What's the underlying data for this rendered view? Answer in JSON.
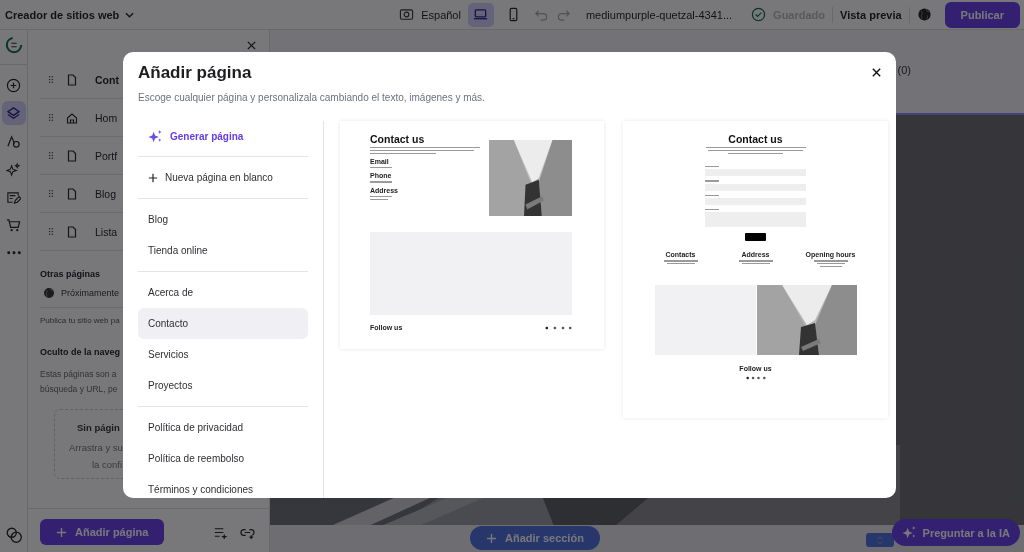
{
  "topbar": {
    "app_title": "Creador de sitios web",
    "language": "Español",
    "devices": [
      {
        "kind": "desktop",
        "selected": true
      },
      {
        "kind": "mobile",
        "selected": false
      }
    ],
    "domain": "mediumpurple-quetzal-4341...",
    "save_status": {
      "label": "Guardado",
      "disabled": true
    },
    "preview": "Vista previa",
    "publish": "Publicar"
  },
  "rail": [
    {
      "kind": "add",
      "selected": false
    },
    {
      "kind": "layers",
      "selected": true
    },
    {
      "kind": "styles",
      "selected": false
    },
    {
      "kind": "ai",
      "selected": false
    },
    {
      "kind": "blog",
      "selected": false
    },
    {
      "kind": "store",
      "selected": false
    },
    {
      "kind": "more",
      "selected": false
    }
  ],
  "sidebar": {
    "pages": [
      {
        "label": "Cont",
        "kind": "page"
      },
      {
        "label": "Hom",
        "kind": "home"
      },
      {
        "label": "Portf",
        "kind": "page"
      },
      {
        "label": "Blog",
        "kind": "page"
      },
      {
        "label": "Lista",
        "kind": "page"
      }
    ],
    "other_heading": "Otras páginas",
    "other_items": [
      "Próximamente"
    ],
    "other_note": "Publica tu sitio web pa",
    "hidden_heading": "Oculto de la naveg",
    "hidden_note": [
      "Estas páginas son a",
      "búsqueda y URL, pe"
    ],
    "empty_title": "Sin págin",
    "empty_lines": [
      "Arrastra y su",
      "la confi"
    ],
    "add_button": "Añadir página"
  },
  "canvas": {
    "count": "(0)",
    "add_section": "Añadir sección",
    "ask_ai": "Preguntar a la IA"
  },
  "modal": {
    "title": "Añadir página",
    "subtitle": "Escoge cualquier página y personalizala cambiando el texto, imágenes y más.",
    "groups": [
      [
        {
          "kind": "generate",
          "label": "Generar página",
          "selected": false
        }
      ],
      [
        {
          "kind": "blank",
          "label": "Nueva página en blanco",
          "selected": false
        }
      ],
      [
        {
          "kind": "page",
          "label": "Blog",
          "selected": false
        },
        {
          "kind": "page",
          "label": "Tienda online",
          "selected": false
        }
      ],
      [
        {
          "kind": "page",
          "label": "Acerca de",
          "selected": false
        },
        {
          "kind": "page",
          "label": "Contacto",
          "selected": true
        },
        {
          "kind": "page",
          "label": "Servicios",
          "selected": false
        },
        {
          "kind": "page",
          "label": "Proyectos",
          "selected": false
        }
      ],
      [
        {
          "kind": "page",
          "label": "Política de privacidad",
          "selected": false
        },
        {
          "kind": "page",
          "label": "Política de reembolso",
          "selected": false
        },
        {
          "kind": "page",
          "label": "Términos y condiciones",
          "selected": false
        }
      ]
    ],
    "templates": [
      {
        "kind": "split",
        "title": "Contact us",
        "labels": [
          "Email",
          "Phone",
          "Address"
        ],
        "footer": "Follow us"
      },
      {
        "kind": "centered",
        "title": "Contact us",
        "columns": [
          "Contacts",
          "Address",
          "Opening hours"
        ],
        "footer": "Follow us"
      }
    ]
  }
}
